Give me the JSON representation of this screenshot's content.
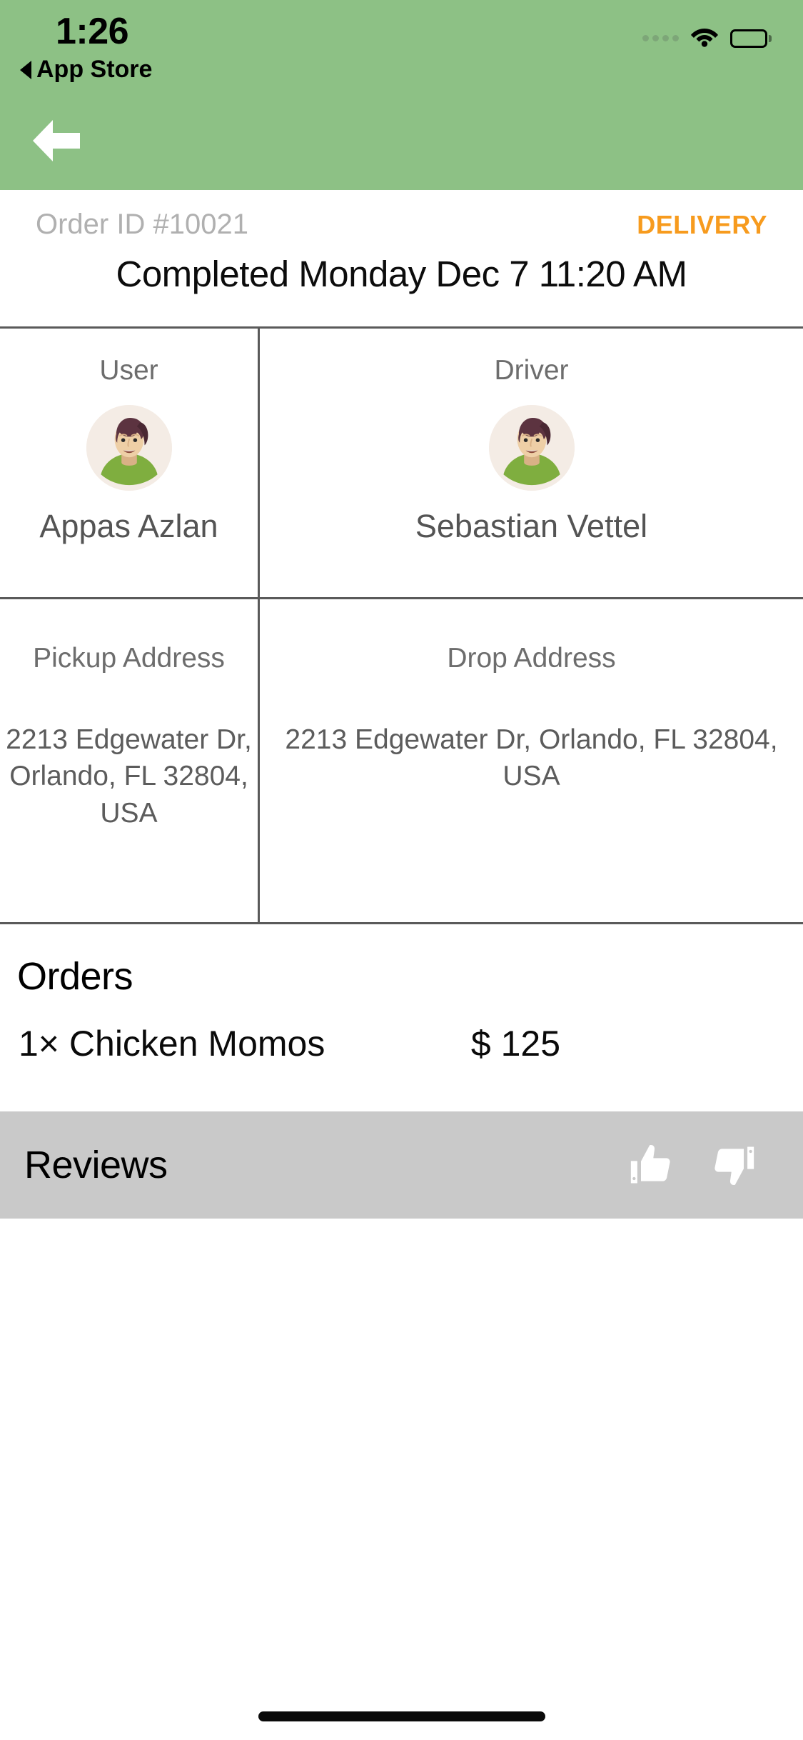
{
  "status_bar": {
    "time": "1:26",
    "back_app_label": "App Store",
    "signal_icon": "signal-dots-icon",
    "wifi_icon": "wifi-icon",
    "battery_icon": "battery-icon"
  },
  "header": {
    "background_color": "#8dc185",
    "back_icon": "arrow-left-icon"
  },
  "order": {
    "id_label": "Order ID #10021",
    "type_label": "DELIVERY",
    "type_color": "#f79b1e",
    "status_label": "Completed Monday Dec 7 11:20 AM"
  },
  "parties": [
    {
      "role_label": "User",
      "name": "Appas Azlan",
      "avatar_icon": "person-avatar-icon"
    },
    {
      "role_label": "Driver",
      "name": "Sebastian Vettel",
      "avatar_icon": "person-avatar-icon"
    }
  ],
  "addresses": [
    {
      "label": "Pickup Address",
      "value": "2213 Edgewater Dr, Orlando, FL 32804, USA"
    },
    {
      "label": "Drop Address",
      "value": "2213 Edgewater Dr, Orlando, FL 32804, USA"
    }
  ],
  "orders": {
    "section_title": "Orders",
    "items": [
      {
        "name": "1× Chicken Momos",
        "price": "$ 125"
      }
    ]
  },
  "reviews": {
    "section_title": "Reviews",
    "background_color": "#c9c9c9",
    "thumbs_up_icon": "thumbs-up-icon",
    "thumbs_down_icon": "thumbs-down-icon"
  }
}
